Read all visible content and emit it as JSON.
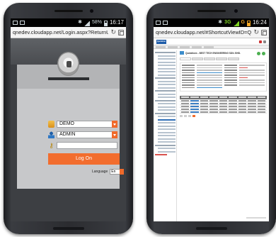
{
  "left_phone": {
    "status_time": "16:17",
    "status_battery": "58%",
    "url": "qnedev.cloudapp.net/Login.aspx?ReturnU",
    "login": {
      "database_value": "DEMO",
      "user_value": "ADMIN",
      "password_value": "",
      "login_button_label": "Log On",
      "language_label": "Language",
      "language_value": "En"
    }
  },
  "right_phone": {
    "status_time": "16:24",
    "status_network": "3G",
    "status_net_letter": "G",
    "url": "qnedev.cloudapp.net/#ShortcutViewID=Quo",
    "dashboard": {
      "logo": "Quotation",
      "record_title": "Quotations - BEST TECH ENGINEERING SDN. BHD."
    }
  },
  "colors": {
    "accent": "#f26d2e",
    "brand_blue": "#1d5ba8",
    "login_panel": "#c7c8ca"
  }
}
